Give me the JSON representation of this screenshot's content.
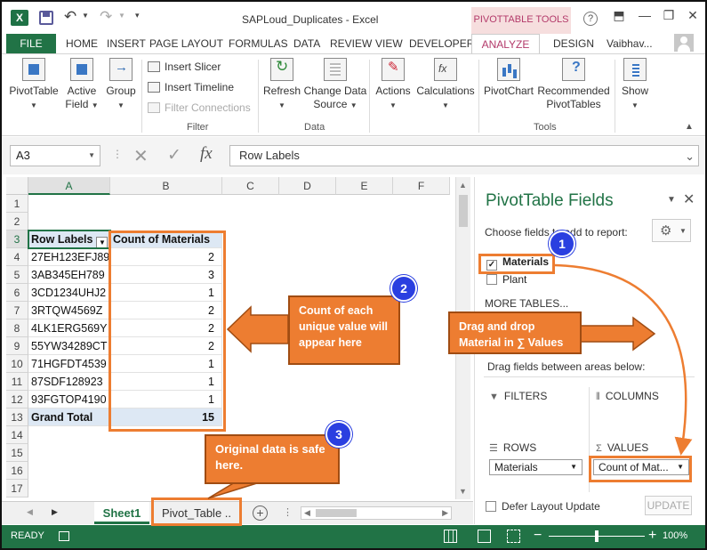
{
  "window": {
    "title": "SAPLoud_Duplicates - Excel",
    "logo_letter": "X",
    "context_tab_header": "PIVOTTABLE TOOLS",
    "user_name": "Vaibhav...",
    "help_label": "?",
    "minimize": "—",
    "restore": "❐",
    "close": "✕"
  },
  "ribbon_tabs": [
    "FILE",
    "HOME",
    "INSERT",
    "PAGE LAYOUT",
    "FORMULAS",
    "DATA",
    "REVIEW",
    "VIEW",
    "DEVELOPER",
    "ANALYZE",
    "DESIGN"
  ],
  "ribbon": {
    "pivottable": "PivotTable",
    "active_field_1": "Active",
    "active_field_2": "Field",
    "group": "Group",
    "insert_slicer": "Insert Slicer",
    "insert_timeline": "Insert Timeline",
    "filter_connections": "Filter Connections",
    "filter_group": "Filter",
    "refresh": "Refresh",
    "change_data_1": "Change Data",
    "change_data_2": "Source",
    "data_group": "Data",
    "actions": "Actions",
    "calculations": "Calculations",
    "pivotchart": "PivotChart",
    "recommended_1": "Recommended",
    "recommended_2": "PivotTables",
    "tools_group": "Tools",
    "show": "Show"
  },
  "formula_bar": {
    "name_box": "A3",
    "formula": "Row Labels",
    "fx": "fx"
  },
  "grid": {
    "columns": [
      "A",
      "B",
      "C",
      "D",
      "E",
      "F"
    ],
    "row_numbers": [
      "1",
      "2",
      "3",
      "4",
      "5",
      "6",
      "7",
      "8",
      "9",
      "10",
      "11",
      "12",
      "13",
      "14",
      "15",
      "16",
      "17"
    ],
    "header_row": {
      "row_labels": "Row Labels",
      "count": "Count of Materials"
    },
    "rows": [
      {
        "label": "27EH123EFJ89",
        "count": "2"
      },
      {
        "label": "3AB345EH789",
        "count": "3"
      },
      {
        "label": "3CD1234UHJ2",
        "count": "1"
      },
      {
        "label": "3RTQW4569Z",
        "count": "2"
      },
      {
        "label": "4LK1ERG569Y",
        "count": "2"
      },
      {
        "label": "55YW34289CT",
        "count": "2"
      },
      {
        "label": "71HGFDT4539",
        "count": "1"
      },
      {
        "label": "87SDF128923",
        "count": "1"
      },
      {
        "label": "93FGTOP4190",
        "count": "1"
      }
    ],
    "grand_total": {
      "label": "Grand Total",
      "count": "15"
    }
  },
  "sheet_tabs": {
    "sheet1": "Sheet1",
    "pivot": "Pivot_Table  .."
  },
  "pivot_pane": {
    "title": "PivotTable Fields",
    "choose_label": "Choose fields to add to report:",
    "fields": [
      {
        "name": "Materials",
        "checked": true
      },
      {
        "name": "Plant",
        "checked": false
      }
    ],
    "more_tables": "MORE TABLES...",
    "drag_label": "Drag fields between areas below:",
    "filters": "FILTERS",
    "columns": "COLUMNS",
    "rows": "ROWS",
    "values": "VALUES",
    "rows_value": "Materials",
    "values_value": "Count of Mat...",
    "defer": "Defer Layout Update",
    "update": "UPDATE"
  },
  "status_bar": {
    "ready": "READY",
    "zoom": "100%",
    "zoom_fraction": 0.5
  },
  "annotations": {
    "badge1": "1",
    "badge2": "2",
    "badge3": "3",
    "callout_count": "Count of each unique value will appear here",
    "callout_drag": "Drag and drop Material in ∑ Values",
    "callout_original": "Original data is safe here."
  },
  "colors": {
    "accent": "#217346",
    "annotation": "#ed7d31",
    "badge": "#2a3fe0",
    "context": "#b33a6a"
  }
}
